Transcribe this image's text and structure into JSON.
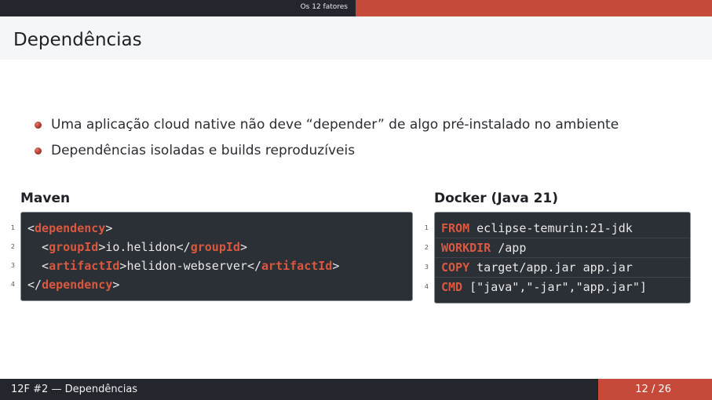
{
  "header": {
    "section": "Os 12 fatores"
  },
  "slide": {
    "title": "Dependências"
  },
  "bullets": [
    "Uma aplicação cloud native não deve “depender” de algo pré-instalado no ambiente",
    "Dependências isoladas e builds reproduzíveis"
  ],
  "maven": {
    "heading": "Maven",
    "lines": [
      {
        "n": "1",
        "a": "<",
        "t1": "dependency",
        "b": ">",
        "v": "",
        "c": "",
        "t2": "",
        "d": ""
      },
      {
        "n": "2",
        "a": "  <",
        "t1": "groupId",
        "b": ">",
        "v": "io.helidon",
        "c": "</",
        "t2": "groupId",
        "d": ">"
      },
      {
        "n": "3",
        "a": "  <",
        "t1": "artifactId",
        "b": ">",
        "v": "helidon-webserver",
        "c": "</",
        "t2": "artifactId",
        "d": ">"
      },
      {
        "n": "4",
        "a": "</",
        "t1": "dependency",
        "b": ">",
        "v": "",
        "c": "",
        "t2": "",
        "d": ""
      }
    ]
  },
  "docker": {
    "heading": "Docker (Java 21)",
    "lines": [
      {
        "n": "1",
        "kw": "FROM",
        "rest": " eclipse-temurin:21-jdk"
      },
      {
        "n": "2",
        "kw": "WORKDIR",
        "rest": " /app"
      },
      {
        "n": "3",
        "kw": "COPY",
        "rest": " target/app.jar app.jar"
      },
      {
        "n": "4",
        "kw": "CMD",
        "rest": " [\"java\",\"-jar\",\"app.jar\"]"
      }
    ]
  },
  "footer": {
    "left": "12F #2 — Dependências",
    "right": "12 / 26"
  },
  "colors": {
    "accent": "#c64a3a",
    "dark": "#23262d",
    "code_bg": "#2b2f36",
    "keyword": "#d9583f"
  }
}
